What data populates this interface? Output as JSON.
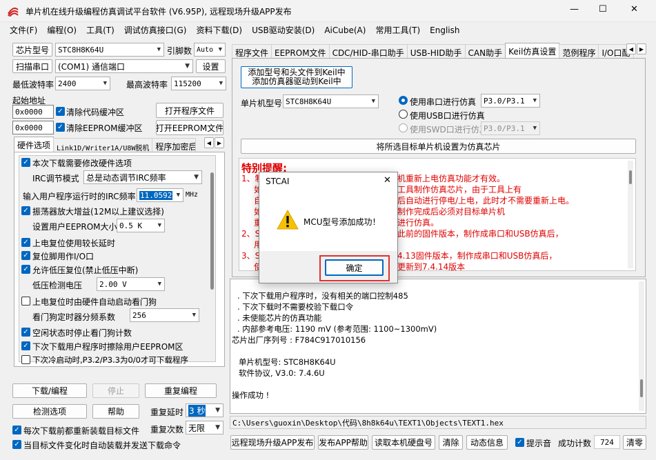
{
  "window": {
    "title": "单片机在线升级编程仿真调试平台软件 (V6.95P), 远程现场升级APP发布",
    "minimize": "—",
    "maximize": "☐",
    "close": "✕"
  },
  "menu": [
    "文件(F)",
    "编程(O)",
    "工具(T)",
    "调试仿真接口(G)",
    "资料下载(D)",
    "USB驱动安装(D)",
    "AiCube(A)",
    "常用工具(T)",
    "English"
  ],
  "left": {
    "chip_btn": "芯片型号",
    "chip_value": "STC8H8K64U",
    "pin_label": "引脚数",
    "pin_value": "Auto",
    "scan_btn": "扫描串口",
    "port_value": "(COM1) 通信端口",
    "settings_btn": "设置",
    "min_baud_label": "最低波特率",
    "min_baud": "2400",
    "max_baud_label": "最高波特率",
    "max_baud": "115200",
    "start_addr_label": "起始地址",
    "addr1": "0x0000",
    "clear_code": "清除代码缓冲区",
    "open_prog": "打开程序文件",
    "addr2": "0x0000",
    "clear_eeprom": "清除EEPROM缓冲区",
    "open_eeprom": "打开EEPROM文件",
    "tabs": [
      "硬件选项",
      "Link1D/Writer1A/U8W脱机",
      "程序加密后"
    ],
    "opts": {
      "o1": "本次下载需要修改硬件选项",
      "irc_mode_label": "IRC调节模式",
      "irc_mode": "总是动态调节IRC频率",
      "irc_freq_label": "输入用户程序运行时的IRC频率",
      "irc_freq": "11.0592",
      "mhz": "MHz",
      "o2": "振荡器放大增益(12M以上建议选择)",
      "eeprom_size_label": "设置用户EEPROM大小",
      "eeprom_size": "0.5 K",
      "o3": "上电复位使用较长延时",
      "o4": "复位脚用作I/O口",
      "o5": "允许低压复位(禁止低压中断)",
      "lv_label": "低压检测电压",
      "lv_value": "2.00 V",
      "o6": "上电复位时由硬件自动启动看门狗",
      "wdt_label": "看门狗定时器分频系数",
      "wdt_value": "256",
      "o7": "空闲状态时停止看门狗计数",
      "o8": "下次下载用户程序时擦除用户EEPROM区",
      "o9": "下次冷启动时,P3.2/P3.3为0/0才可下载程序"
    },
    "download_btn": "下载/编程",
    "stop_btn": "停止",
    "reprog_btn": "重复编程",
    "detect_btn": "检测选项",
    "help_btn": "帮助",
    "repeat_delay_label": "重复延时",
    "repeat_delay": "3 秒",
    "repeat_count_label": "重复次数",
    "repeat_count": "无限",
    "reload_each": "每次下载前都重新装载目标文件",
    "auto_reload": "当目标文件变化时自动装载并发送下载命令"
  },
  "right": {
    "tabs": [
      "程序文件",
      "EEPROM文件",
      "CDC/HID-串口助手",
      "USB-HID助手",
      "CAN助手",
      "Keil仿真设置",
      "范例程序",
      "I/O口配"
    ],
    "add_keil_line1": "添加型号和头文件到Keil中",
    "add_keil_line2": "添加仿真器驱动到Keil中",
    "mcu_label": "单片机型号",
    "mcu_value": "STC8H8K64U",
    "r1": "使用串口进行仿真",
    "r1_port": "P3.0/P3.1",
    "r2": "使用USB口进行仿真",
    "r3": "使用SWD口进行仿真",
    "r3_port": "P3.0/P3.1",
    "set_target_btn": "将所选目标单片机设置为仿真芯片",
    "notice_title": "特别提醒:",
    "notice_lines": [
      "1、制",
      "机重新上电仿真功能才有效。",
      "如",
      "工具制作仿真芯片，由于工具上有",
      "自",
      "后自动进行停电/上电，此时才不需要重新上电。",
      "如",
      "制作完成后必须对目标单片机",
      "重",
      "进行仿真。",
      "2、S",
      "此前的固件版本，制作成串口和USB仿真后，",
      "用",
      "3、S",
      "4.13固件版本，制作成串口和USB仿真后，",
      "使",
      "更新到7.4.14版本"
    ],
    "log_lines": [
      ". 下次下载用户程序时，没有相关的端口控制485",
      ". 下次下载时不需要校验下载口令",
      ". 未使能芯片的仿真功能",
      ". 内部参考电压: 1190 mV (参考范围: 1100~1300mV)",
      "芯片出厂序列号 : F784C917010156",
      "",
      "  单片机型号: STC8H8K64U",
      "  软件协议, V3.0: 7.4.6U",
      "",
      "操作成功 !"
    ],
    "filepath": "C:\\Users\\guoxin\\Desktop\\代码\\8h8k64u\\TEXT1\\Objects\\TEXT1.hex",
    "publish_btn": "远程现场升级APP发布",
    "publish_help_btn": "发布APP帮助",
    "read_disk_btn": "读取本机硬盘号",
    "clear_btn": "清除",
    "anim_btn": "动态信息",
    "beep_label": "提示音",
    "success_label": "成功计数",
    "success_count": "724",
    "clear2_btn": "清零"
  },
  "dialog": {
    "title": "STCAI",
    "message": "MCU型号添加成功！",
    "ok": "确定",
    "close": "✕"
  },
  "colors": {
    "accent": "#0067c0",
    "notice_red": "#e00000",
    "highlight": "#e03030"
  }
}
